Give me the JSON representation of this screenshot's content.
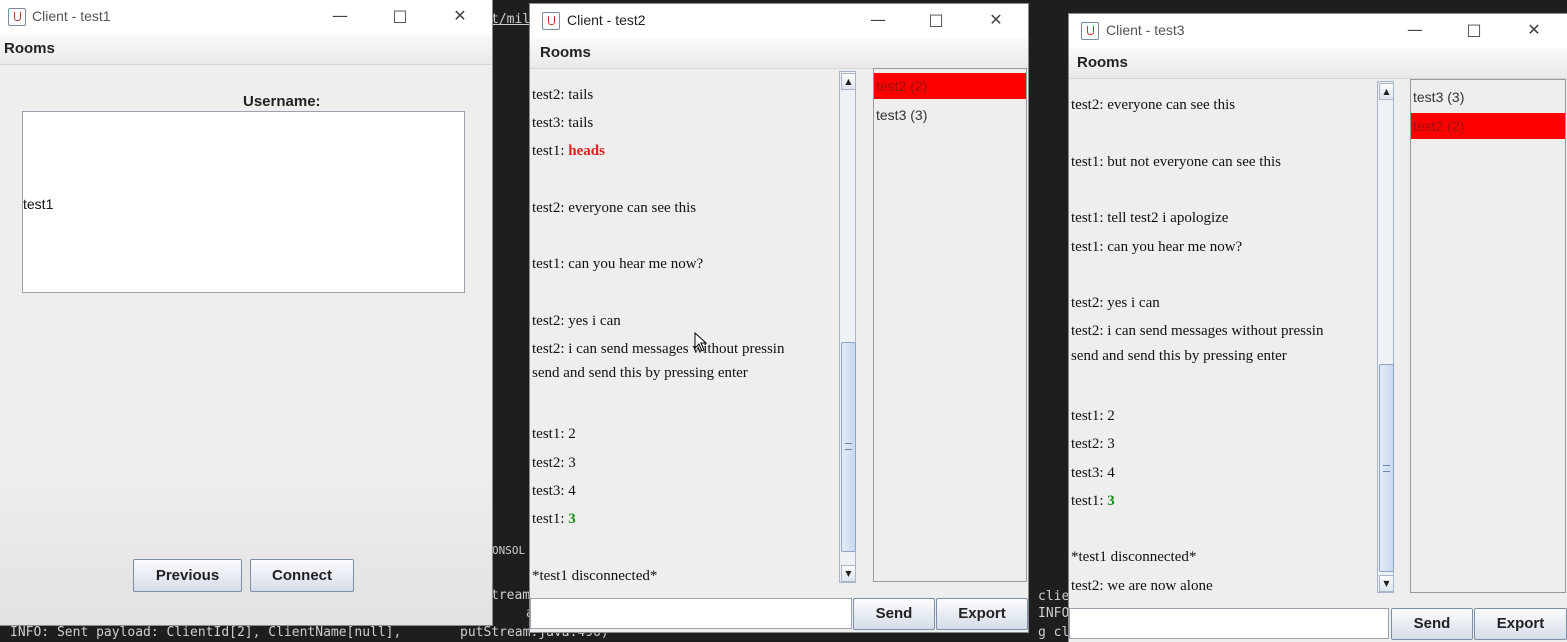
{
  "terminal": {
    "path_fragment": "t/mil",
    "console_label": "ONSOL",
    "stream_fragment": "tream",
    "a_fragment": "a",
    "bottom_line": "INFO: Sent payload: ClientId[2], ClientName[null],",
    "bottom_line2": "putStream.java:496)",
    "right_cli": "clie",
    "right_info": "INFO",
    "right_gcl": "g cl"
  },
  "window1": {
    "title": "Client - test1",
    "menu": "Rooms",
    "username_label": "Username:",
    "username_value": "test1",
    "previous_button": "Previous",
    "connect_button": "Connect"
  },
  "window2": {
    "title": "Client - test2",
    "menu": "Rooms",
    "messages": [
      {
        "prefix": "test2: ",
        "text": "tails"
      },
      {
        "prefix": "test3: ",
        "text": "tails"
      },
      {
        "prefix": "test1: ",
        "text": "heads",
        "style": "bold",
        "color": "#e02020"
      },
      {
        "prefix": "test2: ",
        "text": "everyone can see this"
      },
      {
        "prefix": "test1: ",
        "text": "can you hear me now?"
      },
      {
        "prefix": "test2: ",
        "text": "yes i can"
      },
      {
        "prefix": "test2: ",
        "text": "i can send messages without pressin"
      },
      {
        "prefix": "",
        "text": "send and send this by pressing enter"
      },
      {
        "prefix": "test1: ",
        "text": "2"
      },
      {
        "prefix": "test2: ",
        "text": "3"
      },
      {
        "prefix": "test3: ",
        "text": "4"
      },
      {
        "prefix": "test1: ",
        "text": "3",
        "style": "bold",
        "color": "#1a8f1a"
      },
      {
        "prefix": "",
        "text": "*test1 disconnected*"
      }
    ],
    "users": [
      {
        "label": "test2 (2)",
        "highlight": true
      },
      {
        "label": "test3 (3)",
        "highlight": false
      }
    ],
    "input_value": "",
    "send_button": "Send",
    "export_button": "Export"
  },
  "window3": {
    "title": "Client - test3",
    "menu": "Rooms",
    "messages": [
      {
        "prefix": "test2: ",
        "text": "everyone can see this"
      },
      {
        "prefix": "test1: ",
        "text": "but not everyone can see this"
      },
      {
        "prefix": "test1: ",
        "text": "tell test2 i apologize"
      },
      {
        "prefix": "test1: ",
        "text": "can you hear me now?"
      },
      {
        "prefix": "test2: ",
        "text": "yes i can"
      },
      {
        "prefix": "test2: ",
        "text": "i can send messages without pressin"
      },
      {
        "prefix": "",
        "text": "send and send this by pressing enter"
      },
      {
        "prefix": "test1: ",
        "text": "2"
      },
      {
        "prefix": "test2: ",
        "text": "3"
      },
      {
        "prefix": "test3: ",
        "text": "4"
      },
      {
        "prefix": "test1: ",
        "text": "3",
        "style": "bold",
        "color": "#1a8f1a"
      },
      {
        "prefix": "",
        "text": "*test1 disconnected*"
      },
      {
        "prefix": "test2: ",
        "text": "we are now alone"
      }
    ],
    "users": [
      {
        "label": "test3 (3)",
        "highlight": false
      },
      {
        "label": "test2 (2)",
        "highlight": true
      }
    ],
    "input_value": "",
    "send_button": "Send",
    "export_button": "Export"
  },
  "icons": {
    "app": "java-cup-icon",
    "minimize": "minimize-icon",
    "maximize": "maximize-icon",
    "close": "close-icon",
    "scroll_up": "arrow-up-icon",
    "scroll_down": "arrow-down-icon"
  }
}
